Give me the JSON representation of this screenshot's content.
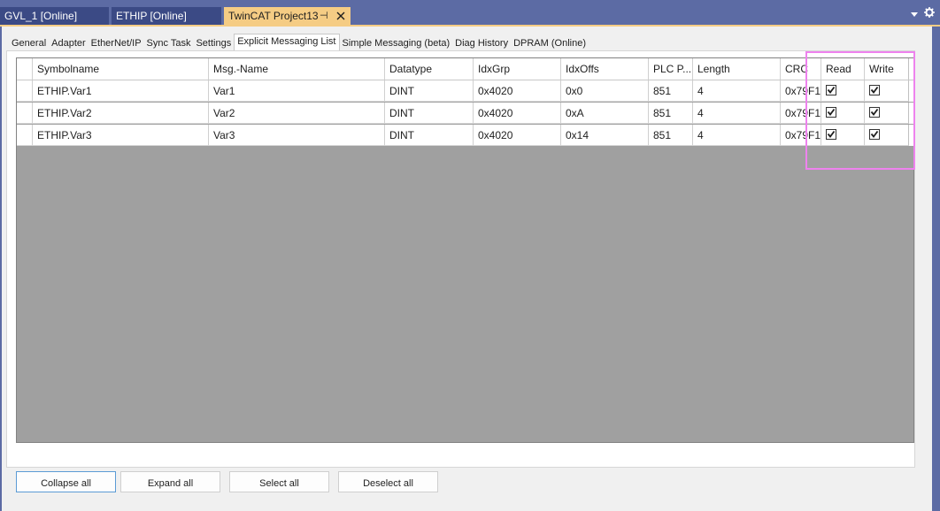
{
  "doc_tabs": [
    {
      "label": "GVL_1 [Online]"
    },
    {
      "label": "ETHIP [Online]"
    },
    {
      "label": "TwinCAT Project13",
      "pin_glyph": "⊣",
      "active": true
    }
  ],
  "page_tabs": [
    {
      "label": "General"
    },
    {
      "label": "Adapter"
    },
    {
      "label": "EtherNet/IP"
    },
    {
      "label": "Sync Task"
    },
    {
      "label": "Settings"
    },
    {
      "label": "Explicit Messaging List",
      "active": true
    },
    {
      "label": "Simple Messaging (beta)"
    },
    {
      "label": "Diag History"
    },
    {
      "label": "DPRAM (Online)"
    }
  ],
  "grid": {
    "columns": [
      "Symbolname",
      "Msg.-Name",
      "Datatype",
      "IdxGrp",
      "IdxOffs",
      "PLC P...",
      "Length",
      "CRC",
      "Read",
      "Write"
    ],
    "rows": [
      {
        "symbolname": "ETHIP.Var1",
        "msg_name": "Var1",
        "datatype": "DINT",
        "idxgrp": "0x4020",
        "idxoffs": "0x0",
        "plc_port": "851",
        "length": "4",
        "crc": "0x79F1",
        "read": true,
        "write": true
      },
      {
        "symbolname": "ETHIP.Var2",
        "msg_name": "Var2",
        "datatype": "DINT",
        "idxgrp": "0x4020",
        "idxoffs": "0xA",
        "plc_port": "851",
        "length": "4",
        "crc": "0x79F1",
        "read": true,
        "write": true
      },
      {
        "symbolname": "ETHIP.Var3",
        "msg_name": "Var3",
        "datatype": "DINT",
        "idxgrp": "0x4020",
        "idxoffs": "0x14",
        "plc_port": "851",
        "length": "4",
        "crc": "0x79F1",
        "read": true,
        "write": true
      }
    ]
  },
  "buttons": {
    "collapse_all": "Collapse all",
    "expand_all": "Expand all",
    "select_all": "Select all",
    "deselect_all": "Deselect all"
  },
  "colors": {
    "frame": "#5c6ba4",
    "active_tab": "#f5cc84",
    "grid_empty": "#a0a0a0",
    "highlight": "#ee82ee"
  },
  "icons": {
    "pin": "pin-icon",
    "close": "close-icon",
    "dropdown": "chevron-down-icon",
    "gear": "gear-icon",
    "check": "checkmark-icon"
  }
}
